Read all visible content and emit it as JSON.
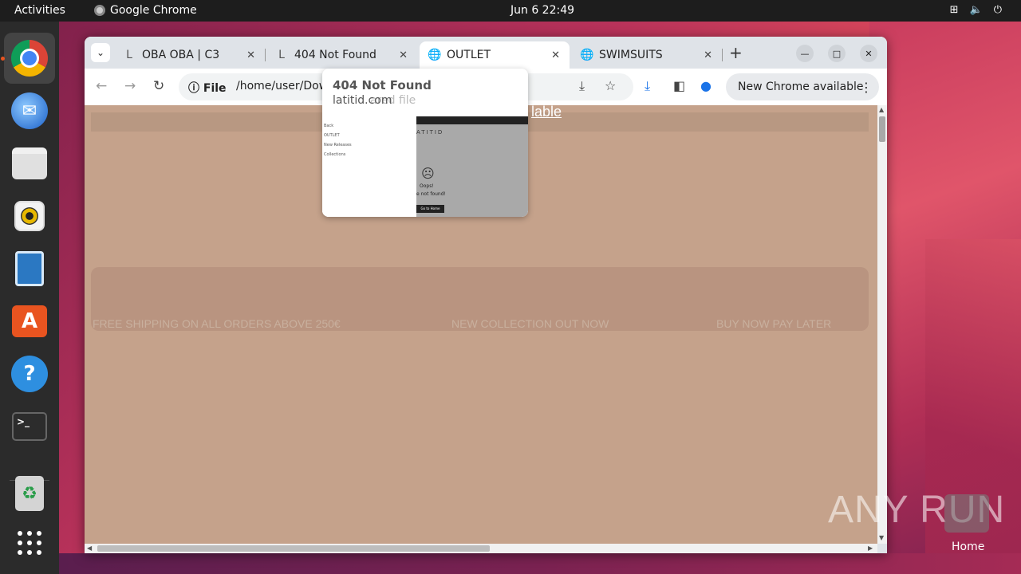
{
  "topbar": {
    "activities": "Activities",
    "app_name": "Google Chrome",
    "clock": "Jun 6  22:49",
    "status_icons": [
      "network-icon",
      "volume-icon",
      "power-icon"
    ]
  },
  "dock": {
    "items": [
      "chrome-icon",
      "thunderbird-icon",
      "files-icon",
      "rhythmbox-icon",
      "writer-icon",
      "app-center-icon",
      "help-icon",
      "terminal-icon",
      "trash-icon",
      "show-apps-icon"
    ]
  },
  "browser": {
    "tabs": [
      {
        "title": "OBA OBA | C3",
        "favicon": "L"
      },
      {
        "title": "404 Not Found",
        "favicon": "L"
      },
      {
        "title": "OUTLET",
        "favicon": "globe"
      },
      {
        "title": "SWIMSUITS",
        "favicon": "globe"
      }
    ],
    "active_tab": 2,
    "new_tab": "+",
    "omnibox": {
      "scheme_label": "File",
      "url": "/home/user/Dow"
    },
    "update_button": "New Chrome available",
    "page": {
      "link_text": "lable",
      "promo": [
        "FREE SHIPPING ON ALL ORDERS ABOVE 250€",
        "NEW COLLECTION OUT NOW",
        "BUY NOW PAY LATER"
      ]
    },
    "hover_card": {
      "title": "404 Not Found",
      "domain": "latitid.com",
      "ghost_text": "ared file",
      "preview": {
        "menu": [
          "Back",
          "OUTLET",
          "New Releases",
          "Collections"
        ],
        "logo": "ATITID",
        "oops": "Oops!",
        "not_found": "e not found!",
        "button": "Go to Home"
      }
    }
  },
  "desktop": {
    "watermark": "ANY RUN",
    "home_label": "Home"
  }
}
